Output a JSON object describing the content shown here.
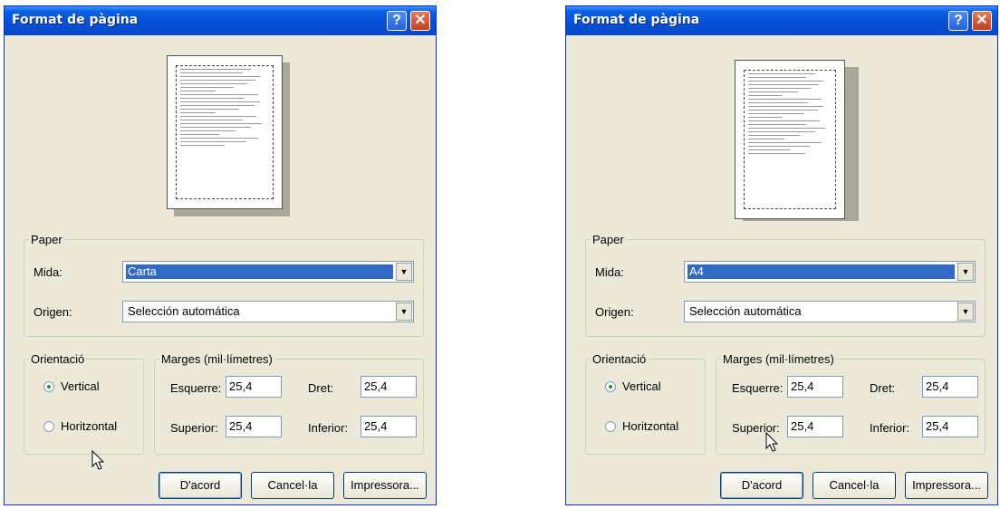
{
  "left": {
    "title": "Format de pàgina",
    "help_glyph": "?",
    "close_glyph": "✕",
    "paper_legend": "Paper",
    "size_label": "Mida:",
    "size_value": "Carta",
    "source_label": "Origen:",
    "source_value": "Selección automática",
    "orientation_legend": "Orientació",
    "portrait_label": "Vertical",
    "landscape_label": "Horitzontal",
    "margins_legend": "Marges (mil·límetres)",
    "left_label": "Esquerre:",
    "left_value": "25,4",
    "right_label": "Dret:",
    "right_value": "25,4",
    "top_label": "Superior:",
    "top_value": "25,4",
    "bottom_label": "Inferior:",
    "bottom_value": "25,4",
    "ok_label": "D'acord",
    "cancel_label": "Cancel·la",
    "printer_label": "Impressora..."
  },
  "right": {
    "title": "Format de pàgina",
    "help_glyph": "?",
    "close_glyph": "✕",
    "paper_legend": "Paper",
    "size_label": "Mida:",
    "size_value": "A4",
    "source_label": "Origen:",
    "source_value": "Selección automática",
    "orientation_legend": "Orientació",
    "portrait_label": "Vertical",
    "landscape_label": "Horitzontal",
    "margins_legend": "Marges (mil·límetres)",
    "left_label": "Esquerre:",
    "left_value": "25,4",
    "right_label": "Dret:",
    "right_value": "25,4",
    "top_label": "Superior:",
    "top_value": "25,4",
    "bottom_label": "Inferior:",
    "bottom_value": "25,4",
    "ok_label": "D'acord",
    "cancel_label": "Cancel·la",
    "printer_label": "Impressora..."
  },
  "colors": {
    "titlebar": "#0550d8",
    "selection": "#316ac5",
    "dialog_bg": "#ece9d8"
  },
  "icons": {
    "help": "help-icon",
    "close": "close-icon",
    "combo_arrow": "chevron-down-icon",
    "cursor": "mouse-cursor-icon"
  }
}
